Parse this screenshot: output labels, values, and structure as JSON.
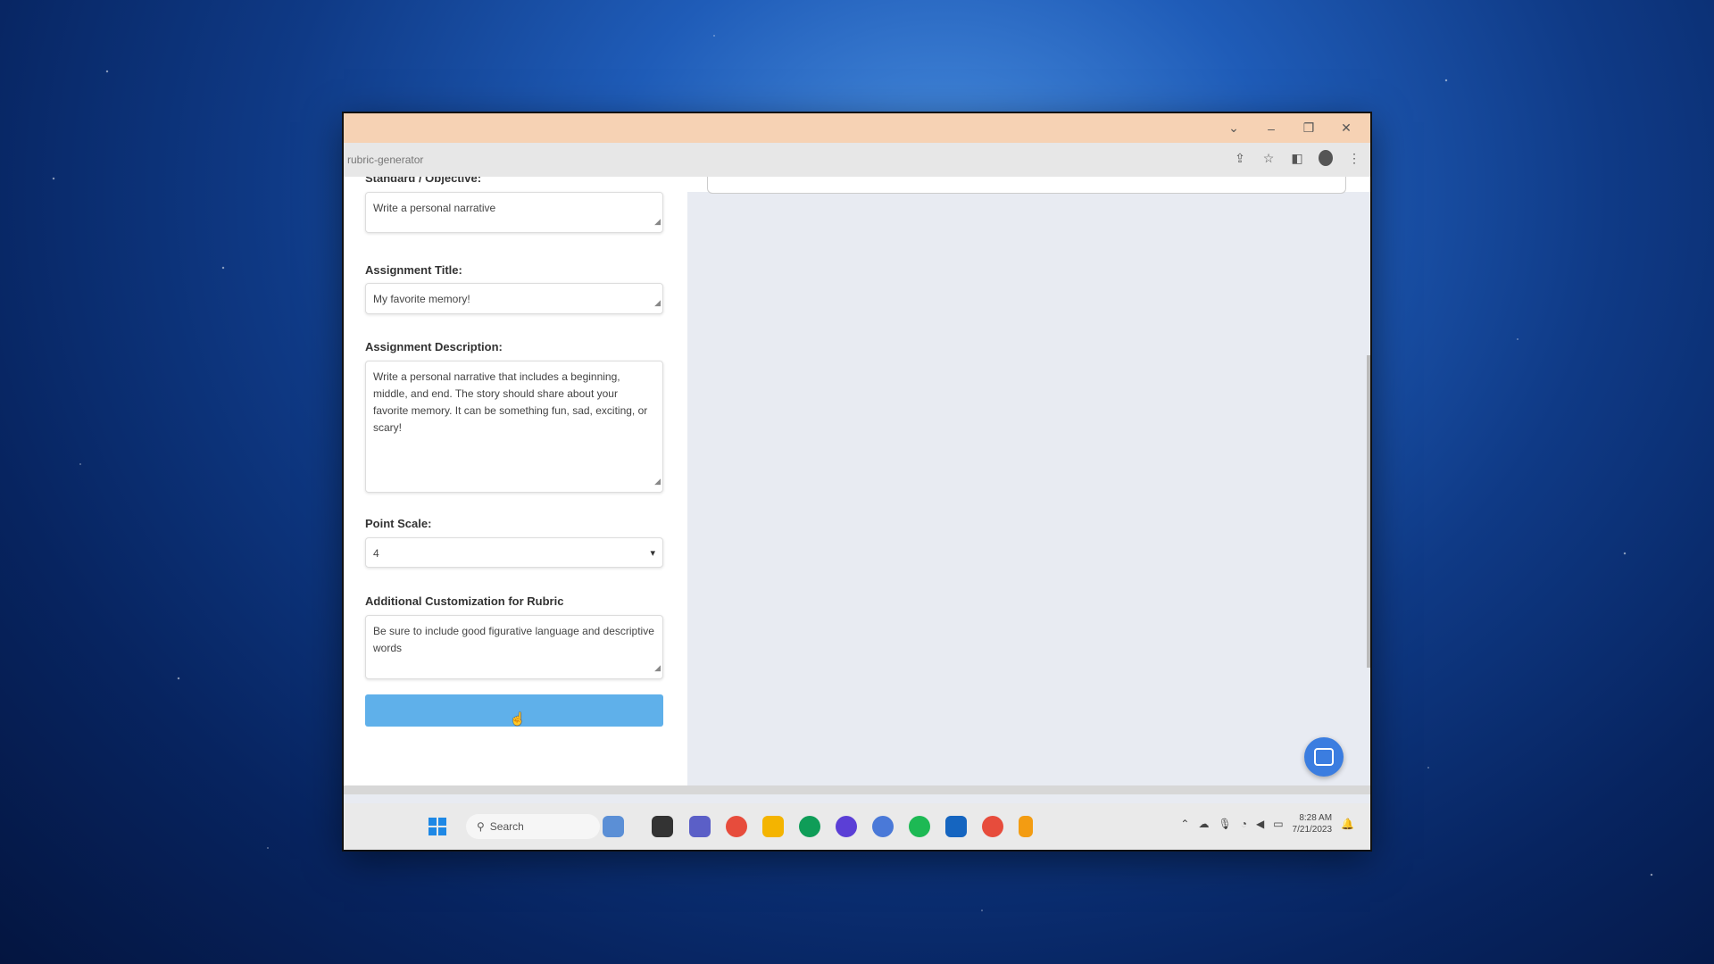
{
  "browser": {
    "url": "rubric-generator"
  },
  "form": {
    "standard_label": "Standard / Objective:",
    "standard_value": "Write a personal narrative",
    "title_label": "Assignment Title:",
    "title_value": "My favorite memory!",
    "description_label": "Assignment Description:",
    "description_value": "Write a personal narrative that includes a beginning, middle, and end. The story should share about your favorite memory. It can be something fun, sad, exciting, or scary!",
    "point_scale_label": "Point Scale:",
    "point_scale_value": "4",
    "customization_label": "Additional Customization for Rubric",
    "customization_value": "Be sure to include good figurative language and descriptive words"
  },
  "taskbar": {
    "search_placeholder": "Search",
    "time": "8:28 AM",
    "date": "7/21/2023"
  },
  "colors": {
    "titlebar": "#f6d2b4",
    "button": "#5fb0ea",
    "chat_button": "#3b7de0"
  }
}
